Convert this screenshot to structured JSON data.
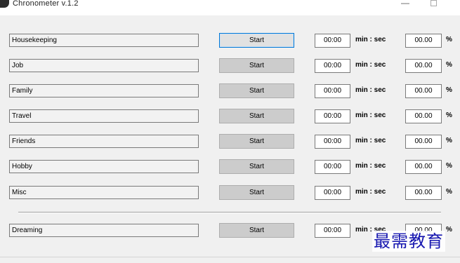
{
  "window": {
    "title": "Chronometer  v.1.2",
    "icon": "app-icon",
    "minimize_glyph": "—"
  },
  "rows": [
    {
      "name": "Housekeeping",
      "start_label": "Start",
      "time": "00:00",
      "unit": "min : sec",
      "percent": "00.00",
      "percent_sign": "%"
    },
    {
      "name": "Job",
      "start_label": "Start",
      "time": "00:00",
      "unit": "min : sec",
      "percent": "00.00",
      "percent_sign": "%"
    },
    {
      "name": "Family",
      "start_label": "Start",
      "time": "00:00",
      "unit": "min : sec",
      "percent": "00.00",
      "percent_sign": "%"
    },
    {
      "name": "Travel",
      "start_label": "Start",
      "time": "00:00",
      "unit": "min : sec",
      "percent": "00.00",
      "percent_sign": "%"
    },
    {
      "name": "Friends",
      "start_label": "Start",
      "time": "00:00",
      "unit": "min : sec",
      "percent": "00.00",
      "percent_sign": "%"
    },
    {
      "name": "Hobby",
      "start_label": "Start",
      "time": "00:00",
      "unit": "min : sec",
      "percent": "00.00",
      "percent_sign": "%"
    },
    {
      "name": "Misc",
      "start_label": "Start",
      "time": "00:00",
      "unit": "min : sec",
      "percent": "00.00",
      "percent_sign": "%"
    }
  ],
  "dreaming_row": {
    "name": "Dreaming",
    "start_label": "Start",
    "time": "00:00",
    "unit": "min : sec",
    "percent": "00.00",
    "percent_sign": "%"
  },
  "watermark": "最需教育",
  "colors": {
    "focus_border": "#0078d7",
    "watermark": "#1616b0"
  }
}
